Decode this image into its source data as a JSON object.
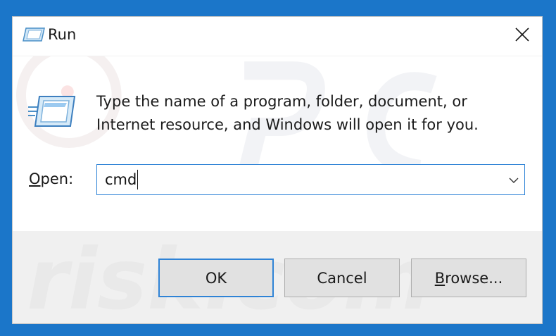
{
  "window": {
    "title": "Run"
  },
  "description": {
    "line1": "Type the name of a program, folder, document, or",
    "line2": "Internet resource, and Windows will open it for you."
  },
  "open": {
    "label_underlined": "O",
    "label_rest": "pen:",
    "value": "cmd"
  },
  "buttons": {
    "ok": "OK",
    "cancel": "Cancel",
    "browse_underlined": "B",
    "browse_rest": "rowse..."
  },
  "watermark": {
    "text": "risk.com"
  },
  "colors": {
    "desktop": "#1b76c9",
    "accent": "#2f83d6",
    "footer": "#f0f0f0"
  }
}
